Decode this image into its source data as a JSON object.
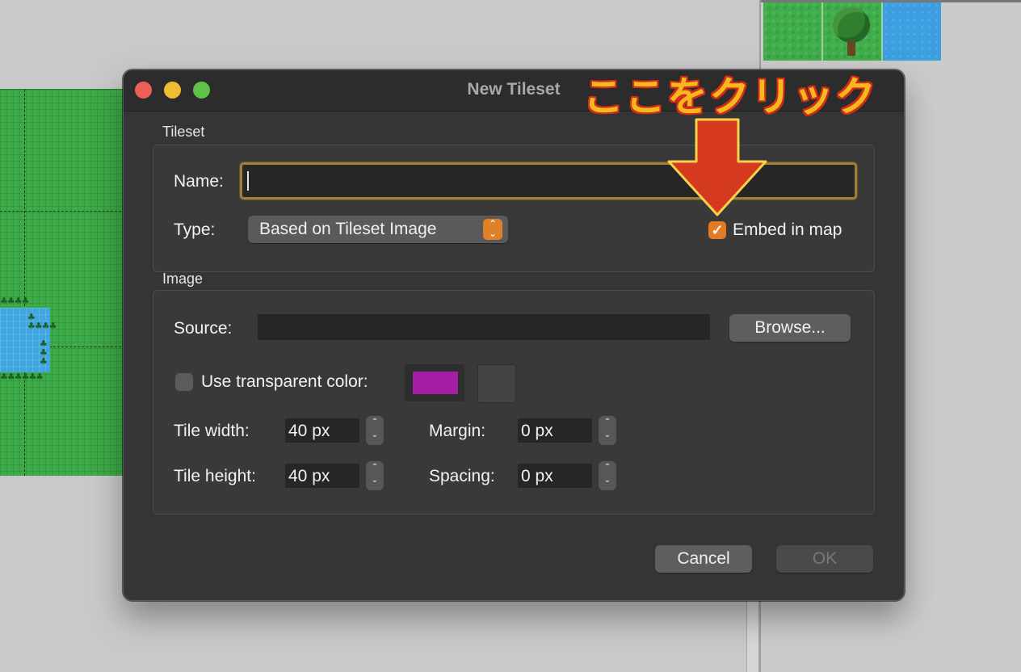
{
  "window": {
    "title": "New Tileset"
  },
  "annotation": {
    "text": "ここをクリック",
    "color_fill": "#f7b81e",
    "color_outline": "#d02d1a"
  },
  "tileset_section": {
    "label": "Tileset",
    "name_label": "Name:",
    "name_value": "",
    "type_label": "Type:",
    "type_value": "Based on Tileset Image",
    "embed_label": "Embed in map",
    "embed_checked": true
  },
  "image_section": {
    "label": "Image",
    "source_label": "Source:",
    "source_value": "",
    "browse_label": "Browse...",
    "transparent_label": "Use transparent color:",
    "transparent_checked": false,
    "transparent_color": "#a51fa5",
    "tile_width_label": "Tile width:",
    "tile_width_value": "40 px",
    "tile_height_label": "Tile height:",
    "tile_height_value": "40 px",
    "margin_label": "Margin:",
    "margin_value": "0 px",
    "spacing_label": "Spacing:",
    "spacing_value": "0 px"
  },
  "buttons": {
    "cancel": "Cancel",
    "ok": "OK"
  },
  "icons": {
    "close": "close-icon",
    "minimize": "minimize-icon",
    "maximize": "maximize-icon",
    "popup_chevron": "up-down-chevron-icon",
    "checkmark": "checkmark-icon",
    "arrow": "arrow-down-icon"
  },
  "colors": {
    "accent": "#e57a25",
    "dialog_bg": "#353535"
  }
}
